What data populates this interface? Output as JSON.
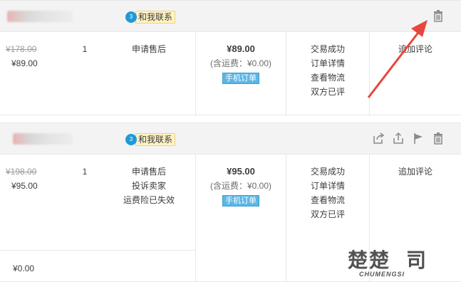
{
  "order1": {
    "contact_label": "和我联系",
    "contact_bubble": "3",
    "original_price": "¥178.00",
    "price": "¥89.00",
    "quantity": "1",
    "service": [
      "申请售后"
    ],
    "total": "¥89.00",
    "shipping_note": "(含运费：¥0.00)",
    "mobile_badge": "手机订单",
    "status": [
      "交易成功",
      "订单详情",
      "查看物流",
      "双方已评"
    ],
    "action": "追加评论"
  },
  "order2": {
    "contact_label": "和我联系",
    "contact_bubble": "3",
    "original_price": "¥198.00",
    "price": "¥95.00",
    "quantity": "1",
    "service": [
      "申请售后",
      "投诉卖家",
      "运费险已失效"
    ],
    "total": "¥95.00",
    "shipping_note": "(含运费：¥0.00)",
    "mobile_badge": "手机订单",
    "status": [
      "交易成功",
      "订单详情",
      "查看物流",
      "双方已评"
    ],
    "action": "追加评论",
    "sub_price": "¥0.00"
  },
  "watermark": {
    "main": "楚楚",
    "side": "司",
    "sub": "CHUMENGSI"
  },
  "colors": {
    "arrow": "#e8463c",
    "badge": "#5bb6e5",
    "contact_bg": "#fff3c4"
  }
}
